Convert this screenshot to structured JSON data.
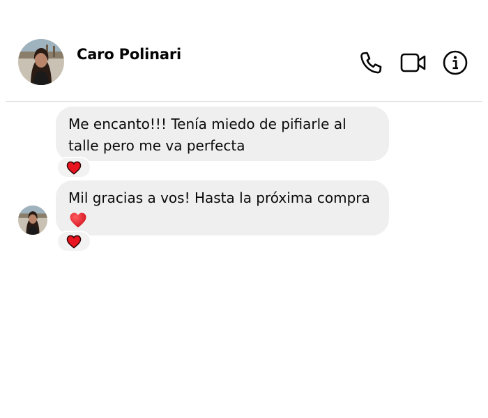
{
  "contact": {
    "name": "Caro Polinari"
  },
  "header_actions": [
    {
      "icon": "phone-icon"
    },
    {
      "icon": "video-camera-icon"
    },
    {
      "icon": "info-icon"
    }
  ],
  "messages": [
    {
      "text": "Me encanto!!! Tenía miedo de pifiarle al talle pero me va perfecta",
      "reaction": "heart-icon"
    },
    {
      "text": "Mil gracias a vos! Hasta la próxima compra",
      "emoji": "heart-icon",
      "reaction": "heart-icon"
    }
  ],
  "colors": {
    "bubble": "#efefef",
    "heart": "#e8141f",
    "divider": "#dcdcdc"
  }
}
